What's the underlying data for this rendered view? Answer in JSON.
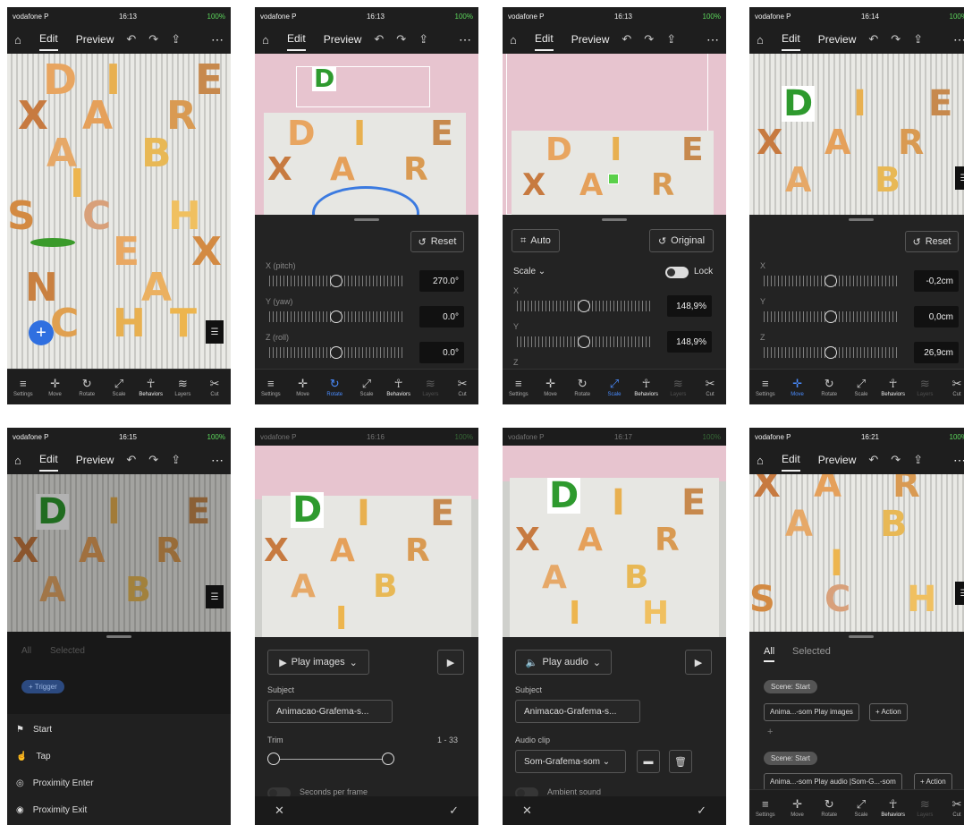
{
  "status": {
    "carrier": "vodafone P",
    "battery": "100%",
    "times": [
      "16:13",
      "16:13",
      "16:13",
      "16:14",
      "16:15",
      "16:16",
      "16:17",
      "16:21"
    ]
  },
  "nav": {
    "edit": "Edit",
    "preview": "Preview"
  },
  "tools": {
    "settings": "Settings",
    "move": "Move",
    "rotate": "Rotate",
    "scale": "Scale",
    "behaviors": "Behaviors",
    "layers": "Layers",
    "cut": "Cut"
  },
  "letters": {
    "d": "D",
    "i": "I",
    "e": "E",
    "x": "X",
    "a": "A",
    "r": "R",
    "b": "B",
    "s": "S",
    "c": "C",
    "h": "H",
    "n": "N",
    "t": "T"
  },
  "rotate": {
    "reset": "Reset",
    "x_label": "X (pitch)",
    "y_label": "Y (yaw)",
    "z_label": "Z (roll)",
    "x": "270.0°",
    "y": "0.0°",
    "z": "0.0°"
  },
  "scale": {
    "auto": "Auto",
    "original": "Original",
    "scale_label": "Scale",
    "lock": "Lock",
    "x_label": "X",
    "y_label": "Y",
    "z_label": "Z",
    "x": "148,9%",
    "y": "148,9%"
  },
  "move": {
    "reset": "Reset",
    "x_label": "X",
    "y_label": "Y",
    "z_label": "Z",
    "x": "-0,2cm",
    "y": "0,0cm",
    "z": "26,9cm"
  },
  "behaviors": {
    "all": "All",
    "selected": "Selected",
    "trigger": "+ Trigger",
    "items": [
      "Start",
      "Tap",
      "Proximity Enter",
      "Proximity Exit"
    ]
  },
  "play_images": {
    "action": "Play images",
    "subject_label": "Subject",
    "subject": "Animacao-Grafema-s...",
    "trim_label": "Trim",
    "trim": "1 - 33",
    "seconds": "Seconds per frame"
  },
  "play_audio": {
    "action": "Play audio",
    "subject_label": "Subject",
    "subject": "Animacao-Grafema-s...",
    "clip_label": "Audio clip",
    "clip": "Som-Grafema-som",
    "ambient": "Ambient sound"
  },
  "list": {
    "all": "All",
    "selected": "Selected",
    "scene1": "Scene: Start",
    "action1": "Anima...-som Play images",
    "add": "+ Action",
    "scene2": "Scene: Start",
    "action2": "Anima...-som Play audio |Som-G...-som",
    "add2": "+ Action"
  }
}
